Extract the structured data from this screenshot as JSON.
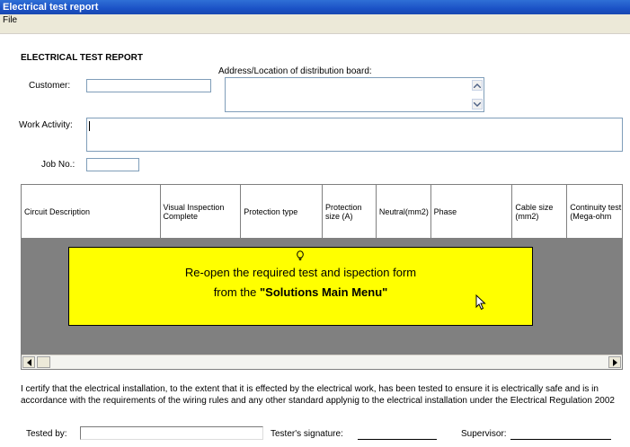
{
  "window": {
    "title": "Electrical  test report"
  },
  "menu": {
    "file": "File"
  },
  "form": {
    "heading": "ELECTRICAL TEST REPORT",
    "customer_label": "Customer:",
    "customer_value": "",
    "address_label": "Address/Location of distribution board:",
    "address_value": "",
    "work_activity_label": "Work Activity:",
    "work_activity_value": "",
    "job_no_label": "Job No.:",
    "job_no_value": ""
  },
  "grid": {
    "columns": [
      "Circuit Description",
      "Visual Inspection Complete",
      "Protection type",
      "Protection size (A)",
      "Neutral(mm2)",
      "Phase",
      "Cable size (mm2)",
      "Continuity test (Mega-ohm"
    ]
  },
  "message": {
    "line1": "Re-open the required test and ispection form",
    "line2_prefix": "from the ",
    "line2_bold": "\"Solutions Main Menu\""
  },
  "certification": {
    "text": "I certify that the electrical installation, to the extent that it is effected by the electrical work, has been tested to ensure it is electrically safe and is in accordance with the requirements of the wiring rules and any other standard applynig to the electrical installation under the Electrical Regulation 2002",
    "tested_by_label": "Tested by:",
    "tested_by_value": "",
    "tester_signature_label": "Tester's signature:",
    "supervisor_label": "Supervisor:"
  }
}
